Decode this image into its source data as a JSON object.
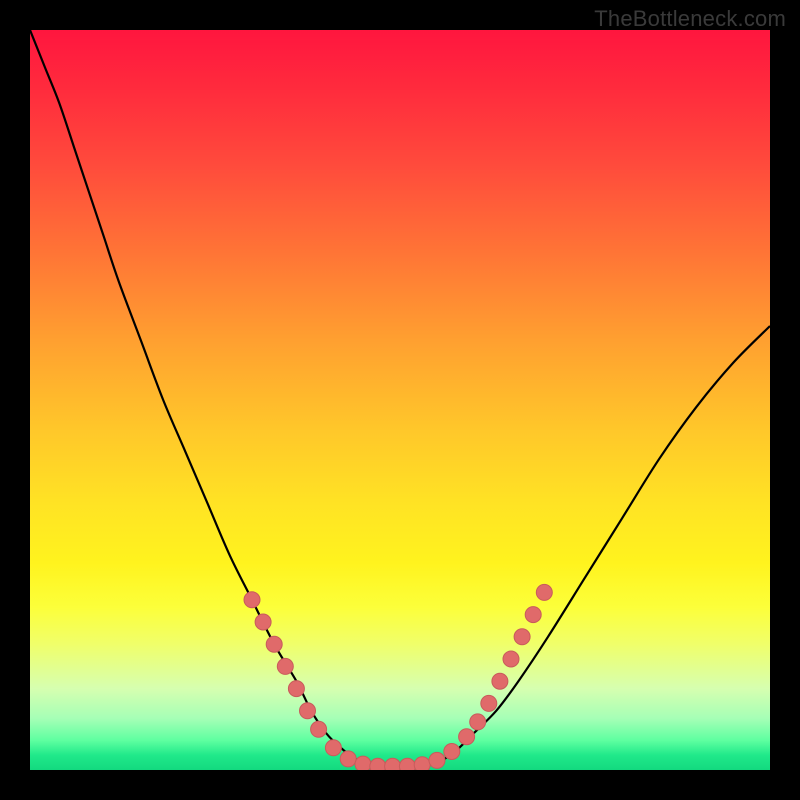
{
  "watermark": "TheBottleneck.com",
  "colors": {
    "frame": "#000000",
    "curve": "#000000",
    "marker_fill": "#e06a6a",
    "marker_stroke": "#c85b5b"
  },
  "chart_data": {
    "type": "line",
    "title": "",
    "xlabel": "",
    "ylabel": "",
    "xlim": [
      0,
      100
    ],
    "ylim": [
      0,
      100
    ],
    "grid": false,
    "legend": false,
    "note": "No axis ticks or numeric labels are rendered; values estimated from pixel positions on a 0–100 normalized scale (origin bottom-left).",
    "series": [
      {
        "name": "curve",
        "x": [
          0,
          2,
          4,
          6,
          8,
          10,
          12,
          15,
          18,
          21,
          24,
          27,
          30,
          33,
          36,
          38,
          40,
          42,
          44,
          46,
          50,
          54,
          56,
          58,
          60,
          63,
          66,
          70,
          75,
          80,
          85,
          90,
          95,
          100
        ],
        "y": [
          100,
          95,
          90,
          84,
          78,
          72,
          66,
          58,
          50,
          43,
          36,
          29,
          23,
          17,
          12,
          8,
          5,
          3,
          1.5,
          0.8,
          0.5,
          0.8,
          1.5,
          3,
          5,
          8,
          12,
          18,
          26,
          34,
          42,
          49,
          55,
          60
        ]
      }
    ],
    "markers": {
      "name": "dots",
      "points": [
        {
          "x": 30,
          "y": 23
        },
        {
          "x": 31.5,
          "y": 20
        },
        {
          "x": 33,
          "y": 17
        },
        {
          "x": 34.5,
          "y": 14
        },
        {
          "x": 36,
          "y": 11
        },
        {
          "x": 37.5,
          "y": 8
        },
        {
          "x": 39,
          "y": 5.5
        },
        {
          "x": 41,
          "y": 3
        },
        {
          "x": 43,
          "y": 1.5
        },
        {
          "x": 45,
          "y": 0.8
        },
        {
          "x": 47,
          "y": 0.5
        },
        {
          "x": 49,
          "y": 0.5
        },
        {
          "x": 51,
          "y": 0.5
        },
        {
          "x": 53,
          "y": 0.7
        },
        {
          "x": 55,
          "y": 1.3
        },
        {
          "x": 57,
          "y": 2.5
        },
        {
          "x": 59,
          "y": 4.5
        },
        {
          "x": 60.5,
          "y": 6.5
        },
        {
          "x": 62,
          "y": 9
        },
        {
          "x": 63.5,
          "y": 12
        },
        {
          "x": 65,
          "y": 15
        },
        {
          "x": 66.5,
          "y": 18
        },
        {
          "x": 68,
          "y": 21
        },
        {
          "x": 69.5,
          "y": 24
        }
      ]
    }
  }
}
